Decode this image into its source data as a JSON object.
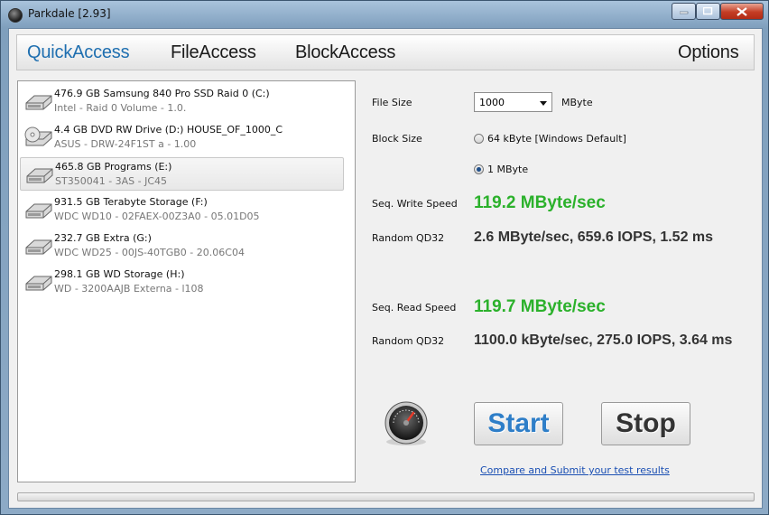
{
  "window": {
    "title": "Parkdale [2.93]"
  },
  "tabs": [
    {
      "label": "QuickAccess",
      "active": true
    },
    {
      "label": "FileAccess",
      "active": false
    },
    {
      "label": "BlockAccess",
      "active": false
    },
    {
      "label": "Options",
      "active": false
    }
  ],
  "drives": [
    {
      "name": "476.9 GB Samsung 840 Pro SSD Raid 0 (C:)",
      "detail": "Intel - Raid 0 Volume - 1.0.",
      "icon": "hard-drive-icon"
    },
    {
      "name": "4.4 GB DVD RW Drive (D:) HOUSE_OF_1000_C",
      "detail": "ASUS - DRW-24F1ST   a - 1.00",
      "icon": "dvd-drive-icon"
    },
    {
      "name": "465.8 GB Programs (E:)",
      "detail": "ST350041 - 3AS - JC45",
      "icon": "hard-drive-icon",
      "selected": true
    },
    {
      "name": "931.5 GB Terabyte Storage (F:)",
      "detail": "WDC WD10 - 02FAEX-00Z3A0 - 05.01D05",
      "icon": "hard-drive-icon"
    },
    {
      "name": "232.7 GB Extra (G:)",
      "detail": "WDC WD25 - 00JS-40TGB0 - 20.06C04",
      "icon": "hard-drive-icon"
    },
    {
      "name": "298.1 GB WD Storage (H:)",
      "detail": "WD - 3200AAJB Externa - l108",
      "icon": "hard-drive-icon"
    }
  ],
  "settings": {
    "file_size_label": "File Size",
    "file_size_value": "1000",
    "file_size_unit": "MByte",
    "block_size_label": "Block Size",
    "block_options": [
      {
        "label": "64 kByte [Windows Default]",
        "checked": false
      },
      {
        "label": "1 MByte",
        "checked": true
      }
    ]
  },
  "results": {
    "seq_write_label": "Seq. Write Speed",
    "seq_write_value": "119.2 MByte/sec",
    "random_write_label": "Random QD32",
    "random_write_value": "2.6 MByte/sec, 659.6 IOPS, 1.52 ms",
    "seq_read_label": "Seq. Read Speed",
    "seq_read_value": "119.7 MByte/sec",
    "random_read_label": "Random QD32",
    "random_read_value": "1100.0 kByte/sec, 275.0 IOPS, 3.64 ms"
  },
  "actions": {
    "start_label": "Start",
    "stop_label": "Stop",
    "compare_link": "Compare and Submit your test results"
  },
  "progress": {
    "fraction": 0
  },
  "colors": {
    "accent_tab": "#1f6fb0",
    "speed_green": "#2bb12b",
    "start_blue": "#2e7ec8",
    "link_blue": "#1a4fb3"
  }
}
